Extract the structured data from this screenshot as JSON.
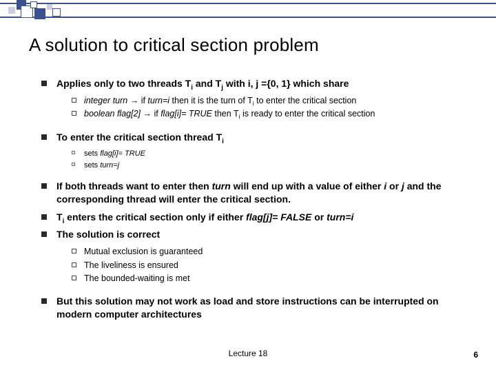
{
  "title": "A solution to critical section problem",
  "b1": {
    "pre": "Applies only to two threads T",
    "sub1": "i",
    "mid1": " and T",
    "sub2": "j",
    "mid2": " with i, j ={0, 1} which share",
    "s1_pre": "integer  turn ",
    "s1_arrow": "→",
    "s1_mid1": " if ",
    "s1_it1": "turn=i",
    "s1_mid2": " then it is the turn of T",
    "s1_sub": "i",
    "s1_post": " to enter the critical section",
    "s2_pre": "boolean flag[2] ",
    "s2_arrow": "→",
    "s2_mid1": " if ",
    "s2_it1": "flag[i]= TRUE",
    "s2_mid2": " then T",
    "s2_sub": "i",
    "s2_post": " is ready to enter the critical section"
  },
  "b2": {
    "pre": "To enter the critical section thread T",
    "sub": "i",
    "s1_pre": "sets ",
    "s1_it": "flag[i]= TRUE",
    "s2_pre": "sets ",
    "s2_it": "turn=j"
  },
  "b3": {
    "pre": "If both threads want to enter then ",
    "it1": "turn",
    "mid": " will end up with a value of either ",
    "it2": "i",
    "or": " or ",
    "it3": "j",
    "post": " and the corresponding thread will enter the critical section."
  },
  "b4": {
    "pre": "T",
    "sub": "i",
    "mid1": " enters the critical section only if either ",
    "it1": "flag[j]= FALSE",
    "mid2": " or ",
    "it2": "turn=i"
  },
  "b5": {
    "text": "The solution is correct",
    "s1": "Mutual exclusion is guaranteed",
    "s2": "The liveliness is ensured",
    "s3": "The bounded-waiting is met"
  },
  "b6": "But this solution may not work as load and store instructions can be interrupted on modern computer architectures",
  "footer": "Lecture 18",
  "page": "6"
}
